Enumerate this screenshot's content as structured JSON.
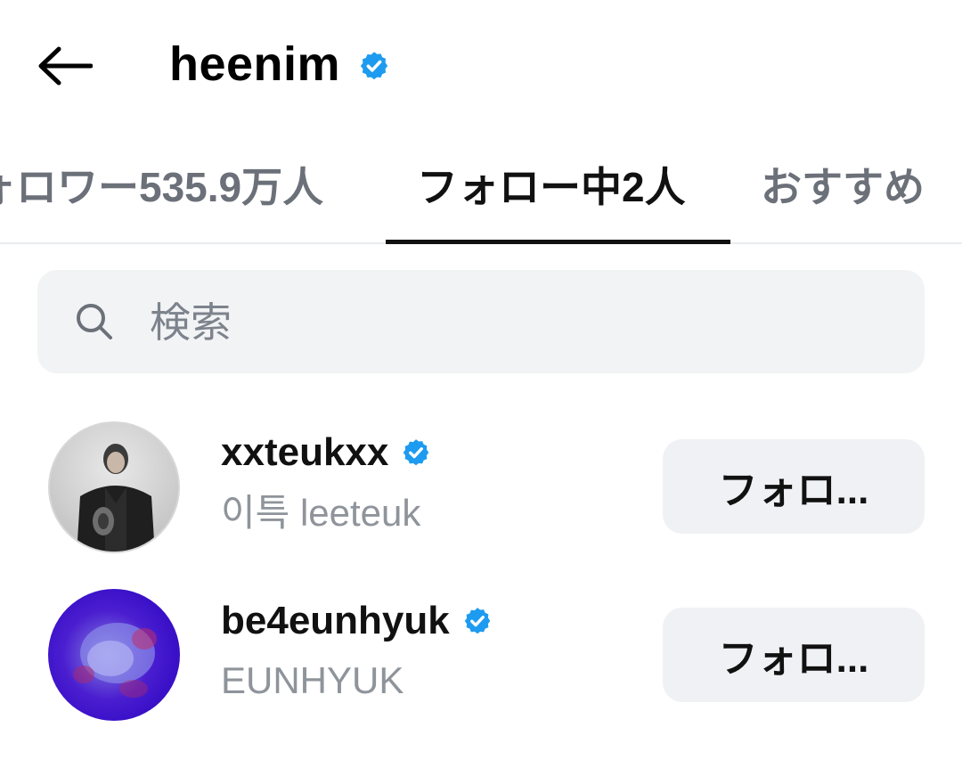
{
  "header": {
    "title": "heenim",
    "back_icon": "arrow-left-icon",
    "verified_icon": "verified-badge-icon"
  },
  "tabs": [
    {
      "label": "ォロワー535.9万人",
      "active": false
    },
    {
      "label": "フォロー中2人",
      "active": true
    },
    {
      "label": "おすすめ",
      "active": false
    }
  ],
  "search": {
    "placeholder": "検索",
    "value": "",
    "icon": "search-icon"
  },
  "users": [
    {
      "username": "xxteukxx",
      "display_name": "이특 leeteuk",
      "verified": true,
      "button_label": "フォロ..."
    },
    {
      "username": "be4eunhyuk",
      "display_name": "EUNHYUK",
      "verified": true,
      "button_label": "フォロ..."
    }
  ],
  "colors": {
    "verified_blue": "#1d9bf0",
    "muted_text": "#6b7079",
    "button_bg": "#f0f1f4",
    "search_bg": "#f2f3f5"
  }
}
